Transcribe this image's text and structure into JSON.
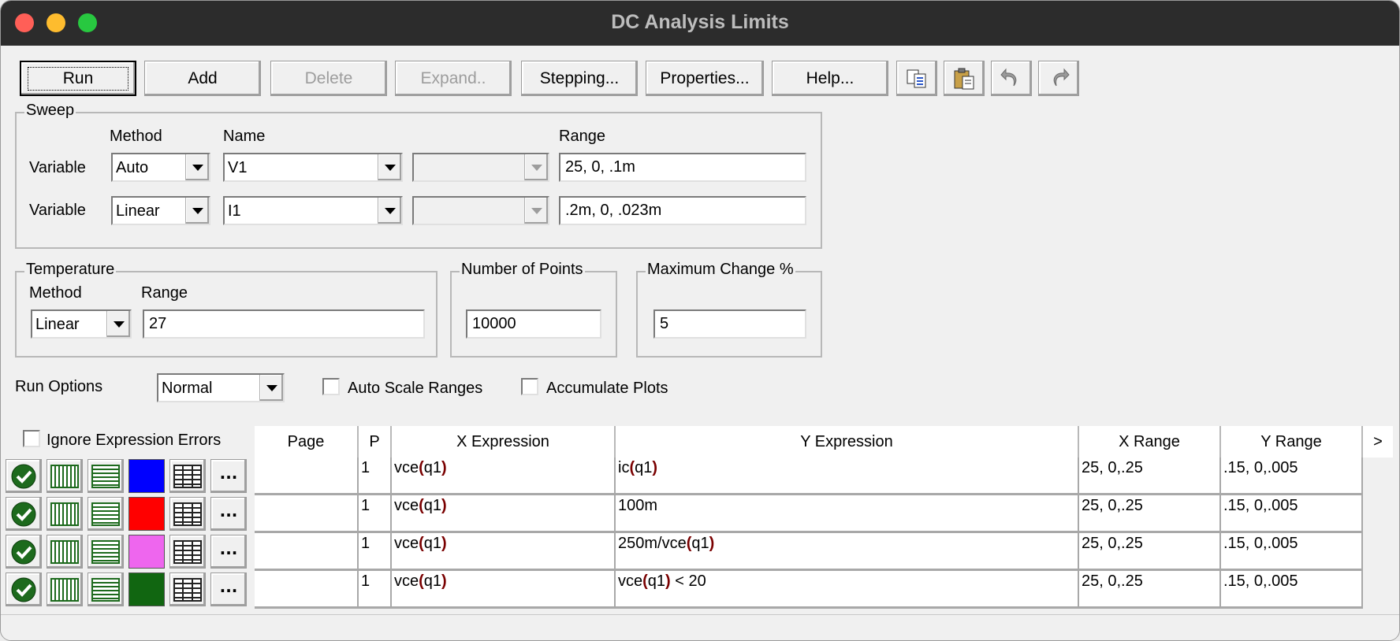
{
  "window": {
    "title": "DC Analysis Limits"
  },
  "toolbar": {
    "run": "Run",
    "add": "Add",
    "delete": "Delete",
    "expand": "Expand..",
    "stepping": "Stepping...",
    "properties": "Properties...",
    "help": "Help..."
  },
  "sweep": {
    "label": "Sweep",
    "headers": {
      "method": "Method",
      "name": "Name",
      "range": "Range"
    },
    "rows": [
      {
        "label": "Variable",
        "method": "Auto",
        "name": "V1",
        "range": "25, 0, .1m"
      },
      {
        "label": "Variable",
        "method": "Linear",
        "name": "I1",
        "range": ".2m, 0, .023m"
      }
    ]
  },
  "temperature": {
    "label": "Temperature",
    "method_label": "Method",
    "range_label": "Range",
    "method": "Linear",
    "range": "27"
  },
  "points": {
    "label": "Number of Points",
    "value": "10000"
  },
  "max_change": {
    "label": "Maximum Change %",
    "value": "5"
  },
  "run_options": {
    "label": "Run Options",
    "value": "Normal",
    "auto_scale": "Auto Scale Ranges",
    "accumulate": "Accumulate Plots"
  },
  "ignore_errors": "Ignore Expression Errors",
  "grid": {
    "headers": {
      "page": "Page",
      "p": "P",
      "x_expr": "X Expression",
      "y_expr": "Y Expression",
      "x_range": "X Range",
      "y_range": "Y Range",
      "more": ">"
    },
    "rows": [
      {
        "color": "#0000ff",
        "p": "1",
        "x_fn": "vce",
        "x_arg": "q1",
        "y_pre": "ic",
        "y_arg": "q1",
        "y_post": "",
        "x_range": "25, 0,.25",
        "y_range": ".15, 0,.005"
      },
      {
        "color": "#ff0000",
        "p": "1",
        "x_fn": "vce",
        "x_arg": "q1",
        "y_pre": "100m",
        "y_arg": "",
        "y_post": "",
        "x_range": "25, 0,.25",
        "y_range": ".15, 0,.005"
      },
      {
        "color": "#ee66ee",
        "p": "1",
        "x_fn": "vce",
        "x_arg": "q1",
        "y_pre": "250m/vce",
        "y_arg": "q1",
        "y_post": "",
        "x_range": "25, 0,.25",
        "y_range": ".15, 0,.005"
      },
      {
        "color": "#116611",
        "p": "1",
        "x_fn": "vce",
        "x_arg": "q1",
        "y_pre": "vce",
        "y_arg": "q1",
        "y_post": " < 20",
        "x_range": "25, 0,.25",
        "y_range": ".15, 0,.005"
      }
    ],
    "more_label": "..."
  }
}
